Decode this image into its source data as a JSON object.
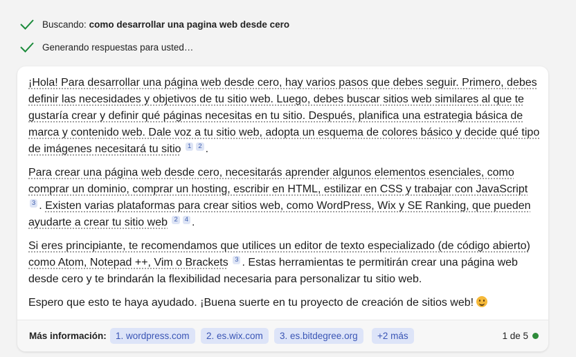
{
  "status": {
    "searching_prefix": "Buscando: ",
    "searching_query": "como desarrollar una pagina web desde cero",
    "generating": "Generando respuestas para usted…"
  },
  "answer": {
    "p1": "¡Hola! Para desarrollar una página web desde cero, hay varios pasos que debes seguir. Primero, debes definir las necesidades y objetivos de tu sitio web. Luego, debes buscar sitios web similares al que te gustaría crear y definir qué páginas necesitas en tu sitio. Después, planifica una estrategia básica de marca y contenido web. Dale voz a tu sitio web, adopta un esquema de colores básico y decide qué tipo de imágenes necesitará tu sitio",
    "p1_cites": [
      "1",
      "2"
    ],
    "p2a": "Para crear una página web desde cero, necesitarás aprender algunos elementos esenciales, como comprar un dominio, comprar un hosting, escribir en HTML, estilizar en CSS y trabajar con JavaScript",
    "p2a_cites": [
      "3"
    ],
    "p2b": "Existen varias plataformas para crear sitios web, como WordPress, Wix y SE Ranking, que pueden ayudarte a crear tu sitio web",
    "p2b_cites": [
      "2",
      "4"
    ],
    "p3a": "Si eres principiante, te recomendamos que utilices un editor de texto especializado (de código abierto) como Atom, Notepad ++, Vim o Brackets",
    "p3a_cites": [
      "3"
    ],
    "p3b": "Estas herramientas te permitirán crear una página web desde cero y te brindarán la flexibilidad necesaria para personalizar tu sitio web.",
    "p4": "Espero que esto te haya ayudado. ¡Buena suerte en tu proyecto de creación de sitios web!",
    "period": "."
  },
  "footer": {
    "label": "Más información:",
    "links": [
      "1. wordpress.com",
      "2. es.wix.com",
      "3. es.bitdegree.org",
      "+2 más"
    ],
    "page_count": "1 de 5"
  },
  "colors": {
    "check": "#1a8a3a",
    "pill_bg": "#dde4f8",
    "pill_text": "#3a55b5",
    "online_dot": "#2e8b3a"
  }
}
